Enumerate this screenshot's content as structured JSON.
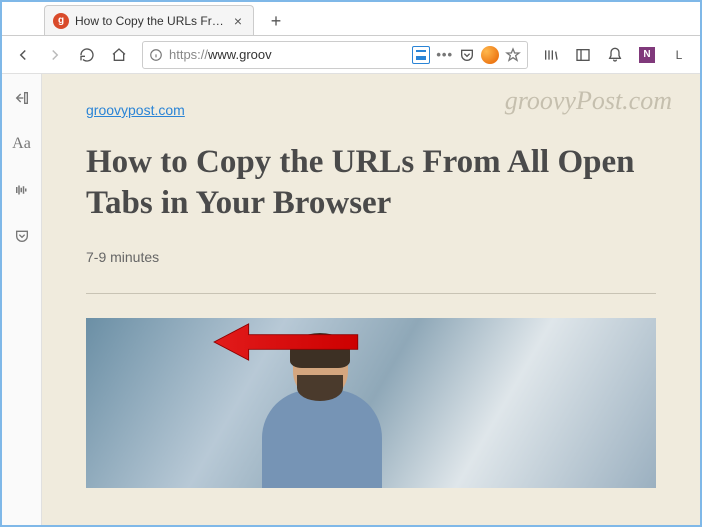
{
  "tab": {
    "title": "How to Copy the URLs From All Open Tabs",
    "favicon_letter": "g"
  },
  "urlbar": {
    "protocol": "https://",
    "display": "www.groov"
  },
  "toolbar_right": {
    "account_letter": "L",
    "onenote_letter": "N"
  },
  "reader": {
    "watermark": "groovyPost.com",
    "site_link": "groovypost.com",
    "title": "How to Copy the URLs From All Open Tabs in Your Browser",
    "read_time": "7-9 minutes"
  },
  "sidebar": {
    "font_label": "Aa"
  }
}
